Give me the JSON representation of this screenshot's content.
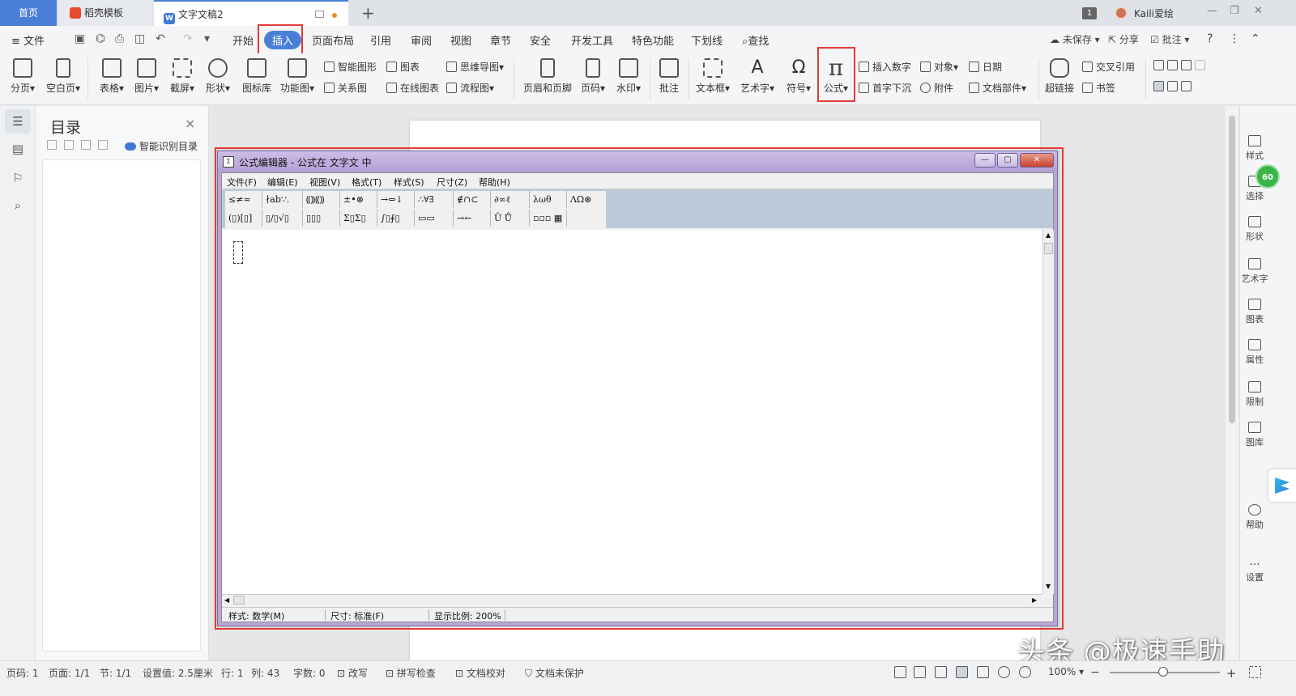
{
  "tabs": {
    "home": "首页",
    "template": "稻壳模板",
    "doc": "文字文稿2",
    "add": "+"
  },
  "window": {
    "badge": "1",
    "user": "Kaili爱绘"
  },
  "menu": {
    "file": "≡ 文件",
    "tabs": [
      "开始",
      "插入",
      "页面布局",
      "引用",
      "审阅",
      "视图",
      "章节",
      "安全",
      "开发工具",
      "特色功能",
      "下划线"
    ],
    "active_tab": "插入",
    "search": "查找",
    "right": {
      "unsaved": "未保存",
      "share": "分享",
      "annotate": "批注",
      "help": "?",
      "more": "⋮"
    }
  },
  "ribbon": {
    "break": "分页",
    "blank_page": "空白页",
    "table": "表格",
    "picture": "图片",
    "screenshot": "截屏",
    "shape": "形状",
    "icon_lib": "图标库",
    "func_chart": "功能图",
    "smart_shape": "智能图形",
    "chart": "图表",
    "mind_map": "思维导图",
    "relation": "关系图",
    "online_chart": "在线图表",
    "flowchart": "流程图",
    "header_footer": "页眉和页脚",
    "page_num": "页码",
    "watermark": "水印",
    "comment": "批注",
    "textbox": "文本框",
    "wordart": "艺术字",
    "symbol": "符号",
    "formula": "公式",
    "insert_number": "插入数字",
    "object": "对象",
    "date": "日期",
    "dropcap": "首字下沉",
    "attachment": "附件",
    "doc_parts": "文档部件",
    "hyperlink": "超链接",
    "crossref": "交叉引用",
    "bookmark": "书签"
  },
  "toc": {
    "title": "目录",
    "smart": "智能识别目录",
    "close": "×"
  },
  "right_panel": {
    "items": [
      "样式",
      "选择",
      "形状",
      "艺术字",
      "图表",
      "属性",
      "限制",
      "图库",
      "帮助",
      "设置"
    ],
    "badge": "60"
  },
  "equation_editor": {
    "title": "公式编辑器 - 公式在 文字文 中",
    "menus": [
      "文件(F)",
      "编辑(E)",
      "视图(V)",
      "格式(T)",
      "样式(S)",
      "尺寸(Z)",
      "帮助(H)"
    ],
    "palette_row1": [
      "≤≠≈",
      "∤ab∵.",
      "⸨⸩⸨⸩",
      "±•⊗",
      "→⇔↓",
      "∴∀∃",
      "∉∩⊂",
      "∂∞ℓ",
      "λωθ",
      "ΛΩ⊛"
    ],
    "palette_row2": [
      "(▯)[▯]",
      "▯/▯√▯",
      "▯▯▯",
      "Σ▯Σ▯",
      "∫▯∮▯",
      "▭▭",
      "→←",
      "Ū Ů",
      "▫▫▫ ▦"
    ],
    "status": {
      "style": "样式: 数学(M)",
      "size": "尺寸: 标准(F)",
      "zoom": "显示比例: 200%"
    }
  },
  "watermark": "头条 @极速手助",
  "statusbar": {
    "page_code": "页码: 1",
    "page": "页面: 1/1",
    "section": "节: 1/1",
    "setting": "设置值: 2.5厘米",
    "row": "行: 1",
    "col": "列: 43",
    "words": "字数: 0",
    "revise": "改写",
    "spell": "拼写检查",
    "proof": "文档校对",
    "protect": "文档未保护",
    "zoom": "100%",
    "minus": "−",
    "plus": "+"
  },
  "colors": {
    "accent": "#4a7fd8",
    "highlight": "#e53935",
    "eq_title": "#b9a6d6"
  }
}
